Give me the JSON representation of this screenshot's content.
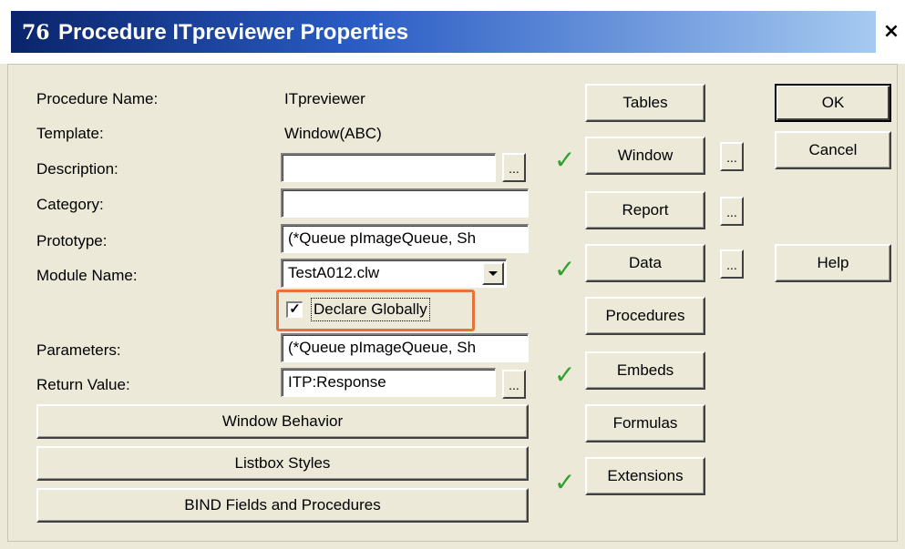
{
  "window": {
    "title": "Procedure ITpreviewer Properties",
    "app_icon": "76",
    "close_label": "×"
  },
  "fields": {
    "procedure_name": {
      "label": "Procedure Name:",
      "value": "ITpreviewer"
    },
    "template": {
      "label": "Template:",
      "value": "Window(ABC)"
    },
    "description": {
      "label": "Description:",
      "value": ""
    },
    "category": {
      "label": "Category:",
      "value": ""
    },
    "prototype": {
      "label": "Prototype:",
      "value": "(*Queue pImageQueue, Sh"
    },
    "module_name": {
      "label": "Module Name:",
      "value": "TestA012.clw"
    },
    "declare_globally": {
      "label": "Declare Globally",
      "checked": true
    },
    "parameters": {
      "label": "Parameters:",
      "value": "(*Queue pImageQueue, Sh"
    },
    "return_value": {
      "label": "Return Value:",
      "value": "ITP:Response"
    }
  },
  "ellipsis_label": "...",
  "wide_buttons": {
    "window_behavior": "Window Behavior",
    "listbox_styles": "Listbox Styles",
    "bind_fields": "BIND Fields and Procedures"
  },
  "side_buttons": {
    "tables": "Tables",
    "window": "Window",
    "report": "Report",
    "data": "Data",
    "procedures": "Procedures",
    "embeds": "Embeds",
    "formulas": "Formulas",
    "extensions": "Extensions"
  },
  "action_buttons": {
    "ok": "OK",
    "cancel": "Cancel",
    "help": "Help"
  },
  "check_mark": "✓",
  "colors": {
    "title_gradient_start": "#0a246a",
    "title_gradient_end": "#a6caf0",
    "check_green": "#2fa12f",
    "highlight_orange": "#e8713c",
    "dialog_bg": "#ece9d8"
  }
}
